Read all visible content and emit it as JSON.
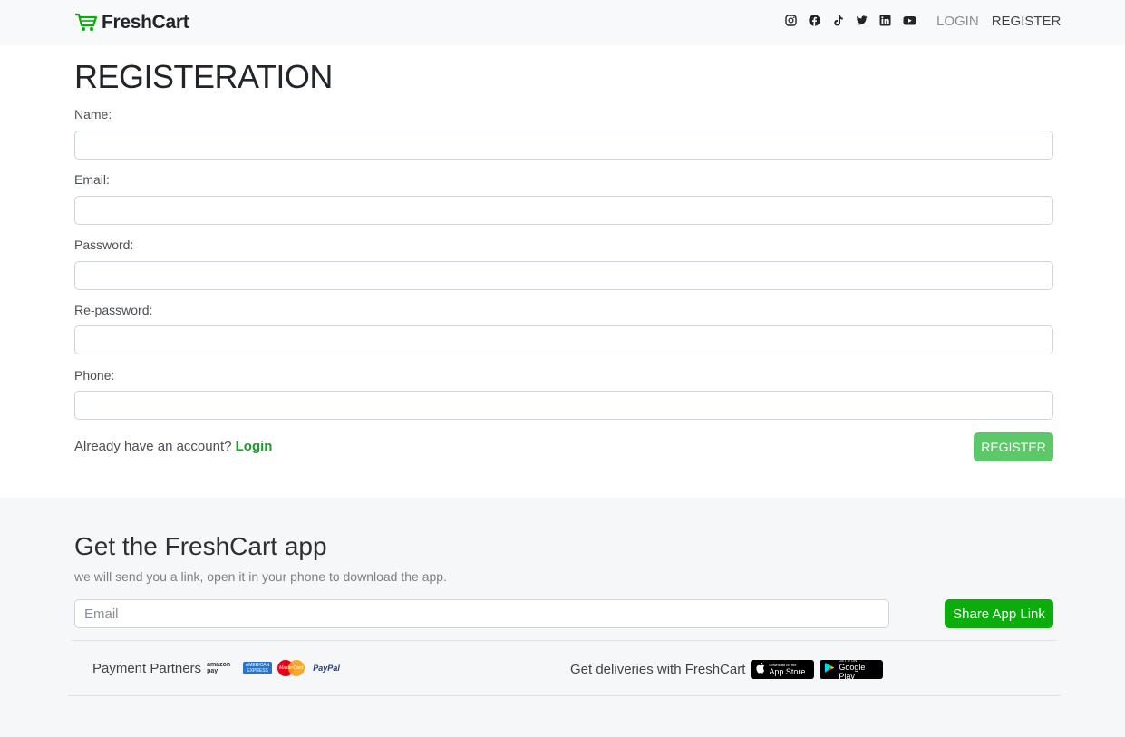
{
  "navbar": {
    "brand": "FreshCart",
    "social_icons": [
      "instagram-icon",
      "facebook-icon",
      "tiktok-icon",
      "twitter-icon",
      "linkedin-icon",
      "youtube-icon"
    ],
    "login_label": "LOGIN",
    "register_label": "REGISTER"
  },
  "form": {
    "title": "REGISTERATION",
    "fields": [
      {
        "label": "Name:",
        "value": ""
      },
      {
        "label": "Email:",
        "value": ""
      },
      {
        "label": "Password:",
        "value": ""
      },
      {
        "label": "Re-password:",
        "value": ""
      },
      {
        "label": "Phone:",
        "value": ""
      }
    ],
    "already_text": "Already have an account?",
    "login_link": "Login",
    "submit_label": "REGISTER"
  },
  "footer": {
    "title": "Get the FreshCart app",
    "subtitle": "we will send you a link, open it in your phone to download the app.",
    "email_placeholder": "Email",
    "share_label": "Share App Link",
    "partners_label": "Payment Partners",
    "partners": [
      "amazon pay",
      "AMERICAN EXPRESS",
      "MasterCard",
      "PayPal"
    ],
    "deliveries_label": "Get deliveries with FreshCart",
    "app_store": {
      "small": "Download on the",
      "big": "App Store"
    },
    "google_play": {
      "small": "GET IT ON",
      "big": "Google Play"
    }
  },
  "colors": {
    "brand_green": "#0aad0a",
    "link_green": "#1e9c2e",
    "register_button": "#5dc869"
  }
}
